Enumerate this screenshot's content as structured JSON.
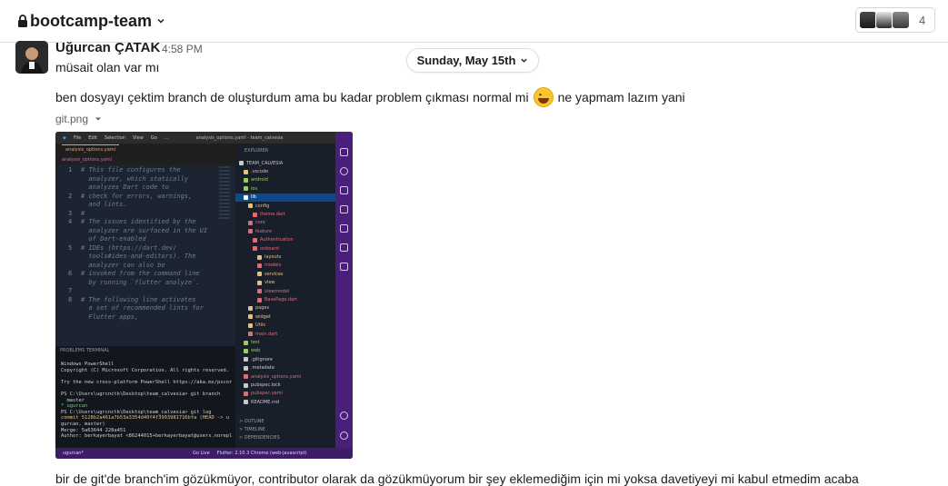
{
  "header": {
    "channel_name": "bootcamp-team",
    "member_count": "4"
  },
  "message": {
    "sender": "Uğurcan ÇATAK",
    "time": "4:58 PM",
    "line1": "müsait olan var mı",
    "line2_before": "ben dosyayı çektim branch de oluşturdum ama bu kadar problem çıkması normal mi",
    "line2_after": "ne yapmam lazım yani",
    "emoji": "grinning-face",
    "attachment_name": "git.png",
    "line3": "bir de git'de branch'im gözükmüyor, contributor olarak da gözükmüyorum bir şey eklemediğim için mi yoksa davetiyeyi mi kabul etmedim acaba"
  },
  "day_divider": {
    "label": "Sunday, May 15th"
  },
  "screenshot": {
    "window_title": "analysis_options.yaml - team_calvesia",
    "menu": [
      "File",
      "Edit",
      "Selection",
      "View",
      "Go",
      "..."
    ],
    "tab": "analysis_options.yaml",
    "breadcrumb": "analysis_options.yaml",
    "code_lines": [
      [
        "1",
        "# This file configures the"
      ],
      [
        "",
        "  analyzer, which statically"
      ],
      [
        "",
        "  analyzes Dart code to"
      ],
      [
        "2",
        "# check for errors, warnings,"
      ],
      [
        "",
        "  and lints."
      ],
      [
        "3",
        "#"
      ],
      [
        "4",
        "# The issues identified by the"
      ],
      [
        "",
        "  analyzer are surfaced in the UI"
      ],
      [
        "",
        "  of Dart-enabled"
      ],
      [
        "5",
        "# IDEs (https://dart.dev/"
      ],
      [
        "",
        "  tools#ides-and-editors). The"
      ],
      [
        "",
        "  analyzer can also be"
      ],
      [
        "6",
        "# invoked from the command line"
      ],
      [
        "",
        "  by running `flutter analyze`."
      ],
      [
        "7",
        ""
      ],
      [
        "8",
        "# The following line activates"
      ],
      [
        "",
        "  a set of recommended lints for"
      ],
      [
        "",
        "  Flutter apps,"
      ]
    ],
    "explorer_title": "EXPLORER",
    "explorer_items": [
      {
        "label": "TEAM_CALVESIA",
        "indent": 0,
        "color": "#c9c9c9",
        "sel": false
      },
      {
        "label": ".vscode",
        "indent": 1,
        "color": "#e5c07b",
        "sel": false
      },
      {
        "label": "android",
        "indent": 1,
        "color": "#9ccc65",
        "sel": false
      },
      {
        "label": "ios",
        "indent": 1,
        "color": "#9ccc65",
        "sel": false
      },
      {
        "label": "lib",
        "indent": 1,
        "color": "#ffffff",
        "sel": true
      },
      {
        "label": "config",
        "indent": 2,
        "color": "#e5c07b",
        "sel": false
      },
      {
        "label": "theme.dart",
        "indent": 3,
        "color": "#e06c75",
        "sel": false
      },
      {
        "label": "core",
        "indent": 2,
        "color": "#e06c75",
        "sel": false
      },
      {
        "label": "feature",
        "indent": 2,
        "color": "#e06c75",
        "sel": false
      },
      {
        "label": "Authentication",
        "indent": 3,
        "color": "#e06c75",
        "sel": false
      },
      {
        "label": "onboard",
        "indent": 3,
        "color": "#e06c75",
        "sel": false
      },
      {
        "label": "layouts",
        "indent": 4,
        "color": "#e5c07b",
        "sel": false
      },
      {
        "label": "models",
        "indent": 4,
        "color": "#e06c75",
        "sel": false
      },
      {
        "label": "services",
        "indent": 4,
        "color": "#e5c07b",
        "sel": false
      },
      {
        "label": "view",
        "indent": 4,
        "color": "#e5c07b",
        "sel": false
      },
      {
        "label": "viewmodel",
        "indent": 4,
        "color": "#e06c75",
        "sel": false
      },
      {
        "label": "BasePage.dart",
        "indent": 4,
        "color": "#e06c75",
        "sel": false
      },
      {
        "label": "pages",
        "indent": 2,
        "color": "#e5c07b",
        "sel": false
      },
      {
        "label": "widget",
        "indent": 2,
        "color": "#e5c07b",
        "sel": false
      },
      {
        "label": "Utils",
        "indent": 2,
        "color": "#e5c07b",
        "sel": false
      },
      {
        "label": "main.dart",
        "indent": 2,
        "color": "#e06c75",
        "sel": false
      },
      {
        "label": "test",
        "indent": 1,
        "color": "#9ccc65",
        "sel": false
      },
      {
        "label": "web",
        "indent": 1,
        "color": "#9ccc65",
        "sel": false
      },
      {
        "label": ".gitignore",
        "indent": 1,
        "color": "#c9c9c9",
        "sel": false
      },
      {
        "label": ".metadata",
        "indent": 1,
        "color": "#c9c9c9",
        "sel": false
      },
      {
        "label": "analysis_options.yaml",
        "indent": 1,
        "color": "#e06c75",
        "sel": false
      },
      {
        "label": "pubspec.lock",
        "indent": 1,
        "color": "#c9c9c9",
        "sel": false
      },
      {
        "label": "pubspec.yaml",
        "indent": 1,
        "color": "#e06c75",
        "sel": false
      },
      {
        "label": "README.md",
        "indent": 1,
        "color": "#c9c9c9",
        "sel": false
      }
    ],
    "explorer_footer": [
      "OUTLINE",
      "TIMELINE",
      "DEPENDENCIES"
    ],
    "terminal_tabs": "PROBLEMS   TERMINAL",
    "terminal_lines": [
      "Windows PowerShell",
      "Copyright (C) Microsoft Corporation. All rights reserved.",
      "",
      "Try the new cross-platform PowerShell https://aka.ms/pscor",
      "",
      "PS C:\\Users\\ugrcnctk\\Desktop\\team_calvesia> git branch",
      "  master",
      "* ugurcan",
      "PS C:\\Users\\ugrcnctk\\Desktop\\team_calvesia> git log",
      "commit 5128b2a461a7b53a3354d40f4f3993981716bfa (HEAD -> u",
      "gurcan, master)",
      "Merge: 5a63644 228a451",
      "Author: berkayerbayat <86244015+berkayerbayat@users.norepl"
    ],
    "status_left": "ugurcan*",
    "status_mid": "Go Live",
    "status_right": "Flutter: 2.10.3   Chrome (web-javascript)"
  }
}
